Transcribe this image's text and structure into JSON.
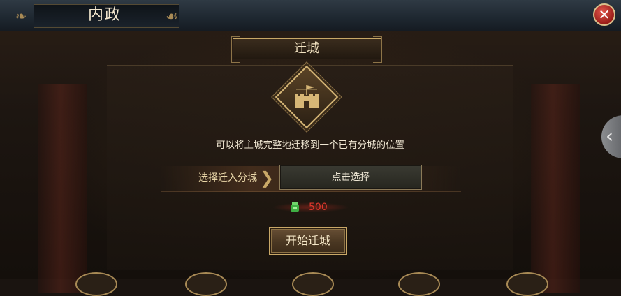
{
  "header": {
    "title": "内政"
  },
  "section": {
    "title": "迁城"
  },
  "panel": {
    "description": "可以将主城完整地迁移到一个已有分城的位置",
    "select_label": "选择迁入分城",
    "select_button": "点击选择",
    "cost": "500",
    "start_button": "开始迁城"
  },
  "icons": {
    "close": "close-icon",
    "chevron": "chevron-right-icon",
    "side_arrow": "chevron-left-icon",
    "emblem": "city-wall-icon",
    "cost": "jade-icon"
  },
  "colors": {
    "accent_gold": "#c9a867",
    "cost_red": "#e0382c",
    "close_red": "#b8241c"
  }
}
